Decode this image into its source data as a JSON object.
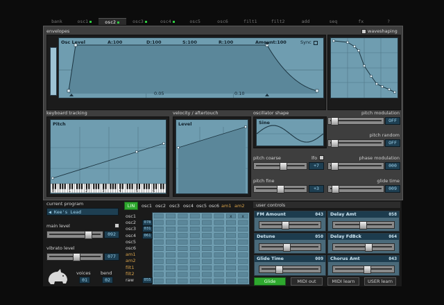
{
  "tabs": [
    {
      "label": "bank",
      "active": false,
      "dot": false
    },
    {
      "label": "osc1",
      "active": false,
      "dot": true
    },
    {
      "label": "osc2",
      "active": true,
      "dot": true
    },
    {
      "label": "osc3",
      "active": false,
      "dot": true
    },
    {
      "label": "osc4",
      "active": false,
      "dot": true
    },
    {
      "label": "osc5",
      "active": false,
      "dot": false
    },
    {
      "label": "osc6",
      "active": false,
      "dot": false
    },
    {
      "label": "filt1",
      "active": false,
      "dot": false
    },
    {
      "label": "filt2",
      "active": false,
      "dot": false
    },
    {
      "label": "add",
      "active": false,
      "dot": false
    },
    {
      "label": "seq",
      "active": false,
      "dot": false
    },
    {
      "label": "fx",
      "active": false,
      "dot": false
    },
    {
      "label": "?",
      "active": false,
      "dot": false
    }
  ],
  "sections": {
    "envelopes": "envelopes",
    "waveshaping": "waveshaping",
    "keyboard_tracking": "keyboard tracking",
    "velocity": "velocity / aftertouch",
    "osc_shape": "oscillator shape",
    "user_controls": "user controls",
    "current_program": "current program",
    "main_level": "main level",
    "vibrato_level": "vibrato level",
    "voices": "voices",
    "bend": "bend"
  },
  "envelope": {
    "target": "Osc Level",
    "attack": "A:100",
    "decay": "D:100",
    "sustain": "S:100",
    "release": "R:100",
    "amount": "Amount:100",
    "sync": "Sync",
    "tick1": "0.05",
    "tick2": "0.10"
  },
  "keyboard": {
    "target": "Pitch",
    "keys": [
      "0",
      "1",
      "2",
      "3",
      "4",
      "5",
      "6"
    ]
  },
  "velocity": {
    "target": "Level"
  },
  "osc_shape": {
    "label": "Sine"
  },
  "right_controls": [
    {
      "label": "pitch modulation",
      "value": "OFF",
      "level": 0.06
    },
    {
      "label": "pitch random",
      "value": "OFF",
      "level": 0.06
    },
    {
      "label": "phase modulation",
      "value": "000",
      "level": 0.06
    },
    {
      "label": "glide time",
      "value": "009",
      "level": 0.07
    }
  ],
  "pitch_coarse": {
    "label": "pitch coarse",
    "lfo": "lfo",
    "value": "+7",
    "level": 0.58
  },
  "pitch_fine": {
    "label": "pitch fine",
    "value": "+3",
    "level": 0.52
  },
  "program": {
    "name": "Kee's Lead"
  },
  "main_level": {
    "value": "092",
    "level": 0.8
  },
  "vibrato_level": {
    "value": "077",
    "level": 0.55
  },
  "voices": {
    "value": "01"
  },
  "bend": {
    "value": "02"
  },
  "matrix": {
    "lin": "LIN",
    "columns": [
      {
        "label": "osc1",
        "amber": false
      },
      {
        "label": "osc2",
        "amber": false
      },
      {
        "label": "osc3",
        "amber": false
      },
      {
        "label": "osc4",
        "amber": false
      },
      {
        "label": "osc5",
        "amber": false
      },
      {
        "label": "osc6",
        "amber": false
      },
      {
        "label": "am1",
        "amber": true
      },
      {
        "label": "am2",
        "amber": true
      }
    ],
    "rows": [
      {
        "label": "osc1",
        "amber": false,
        "value": ""
      },
      {
        "label": "osc2",
        "amber": false,
        "value": "078"
      },
      {
        "label": "osc3",
        "amber": false,
        "value": "031"
      },
      {
        "label": "osc4",
        "amber": false,
        "value": "061"
      },
      {
        "label": "osc5",
        "amber": false,
        "value": ""
      },
      {
        "label": "osc6",
        "amber": false,
        "value": ""
      },
      {
        "label": "am1",
        "amber": true,
        "value": ""
      },
      {
        "label": "am2",
        "amber": true,
        "value": ""
      },
      {
        "label": "filt1",
        "amber": true,
        "value": ""
      },
      {
        "label": "filt2",
        "amber": true,
        "value": ""
      },
      {
        "label": "raw",
        "amber": false,
        "value": "055"
      }
    ],
    "x_mark": "x"
  },
  "user_controls": [
    {
      "label": "FM Amount",
      "value": "043",
      "level": 0.42
    },
    {
      "label": "Delay Amt",
      "value": "058",
      "level": 0.5
    },
    {
      "label": "Detune",
      "value": "050",
      "level": 0.45
    },
    {
      "label": "Delay FdBck",
      "value": "064",
      "level": 0.6
    },
    {
      "label": "Glide Time",
      "value": "009",
      "level": 0.3
    },
    {
      "label": "Chorus Amt",
      "value": "043",
      "level": 0.58
    }
  ],
  "buttons": {
    "glide": "Glide",
    "midi_out": "MIDI out",
    "midi_learn": "MIDI learn",
    "user_learn": "USER learn"
  },
  "colors": {
    "screen": "#6f9db0",
    "lcd": "#1e3f52",
    "active_green": "#2ea82e"
  }
}
